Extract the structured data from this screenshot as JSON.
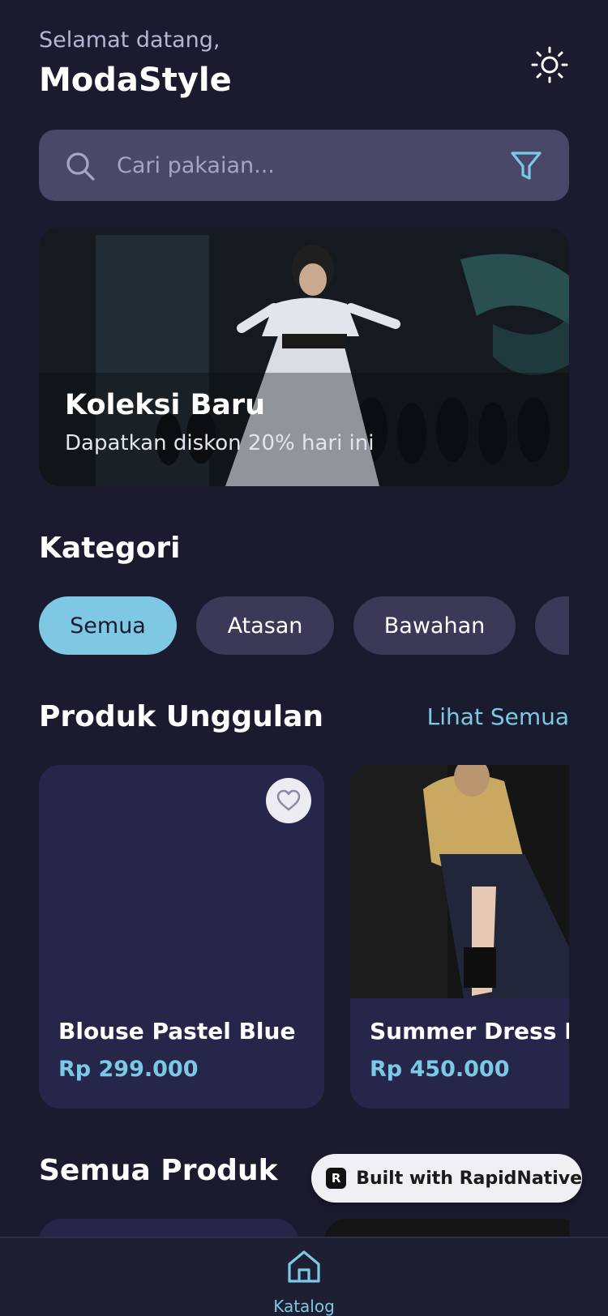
{
  "header": {
    "greeting": "Selamat datang,",
    "brand": "ModaStyle",
    "theme_icon": "sun-icon"
  },
  "search": {
    "placeholder": "Cari pakaian...",
    "search_icon": "search-icon",
    "filter_icon": "filter-icon"
  },
  "banner": {
    "title": "Koleksi Baru",
    "subtitle": "Dapatkan diskon 20% hari ini"
  },
  "categories": {
    "title": "Kategori",
    "items": [
      {
        "label": "Semua",
        "active": true
      },
      {
        "label": "Atasan",
        "active": false
      },
      {
        "label": "Bawahan",
        "active": false
      },
      {
        "label": "",
        "active": false
      }
    ]
  },
  "featured": {
    "title": "Produk Unggulan",
    "see_all": "Lihat Semua",
    "products": [
      {
        "name": "Blouse Pastel Blue",
        "price": "Rp 299.000",
        "favorite_icon": "heart-icon"
      },
      {
        "name": "Summer Dress Ele",
        "price": "Rp 450.000"
      }
    ]
  },
  "all_products": {
    "title": "Semua Produk"
  },
  "badge": {
    "text": "Built with RapidNative",
    "logo": "R"
  },
  "tabbar": {
    "items": [
      {
        "label": "Katalog",
        "icon": "home-icon",
        "active": true
      }
    ]
  },
  "colors": {
    "background": "#1b1b2f",
    "card": "#26264a",
    "accent": "#7ec8e3",
    "chip": "#3b3958",
    "search": "#4a4869"
  }
}
